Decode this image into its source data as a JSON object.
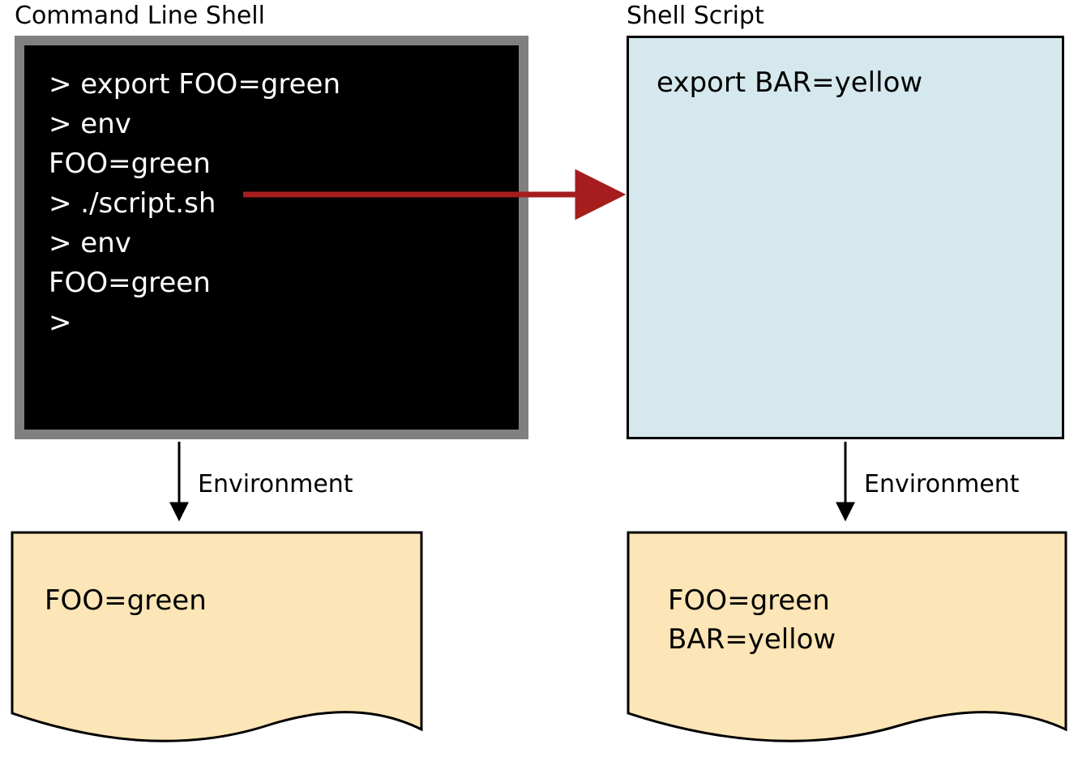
{
  "labels": {
    "terminal_title": "Command Line Shell",
    "script_title": "Shell Script",
    "env_left_label": "Environment",
    "env_right_label": "Environment"
  },
  "terminal": {
    "lines": [
      "> export FOO=green",
      "> env",
      "FOO=green",
      "> ./script.sh",
      "> env",
      "FOO=green",
      ">"
    ]
  },
  "script": {
    "lines": [
      "export BAR=yellow"
    ]
  },
  "env_left": {
    "lines": [
      "FOO=green"
    ]
  },
  "env_right": {
    "lines": [
      "FOO=green",
      "BAR=yellow"
    ]
  },
  "colors": {
    "terminal_bg": "#000000",
    "terminal_border": "#808080",
    "script_bg": "#d5e8ed",
    "env_bg": "#fce5b6",
    "arrow_red": "#a51d1d",
    "arrow_black": "#000000"
  }
}
